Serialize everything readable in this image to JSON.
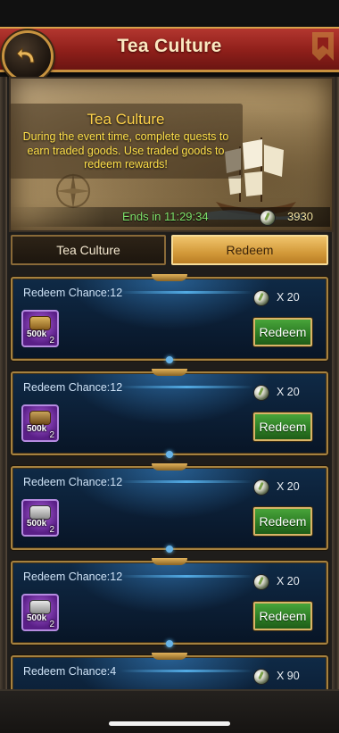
{
  "header": {
    "title": "Tea Culture"
  },
  "banner": {
    "title": "Tea Culture",
    "description": "During the event time, complete quests to earn traded goods.  Use traded goods to redeem rewards!",
    "timer": "Ends in 11:29:34",
    "goods_count": "3930"
  },
  "tabs": [
    {
      "label": "Tea Culture",
      "active": false
    },
    {
      "label": "Redeem",
      "active": true
    }
  ],
  "redeem_items": [
    {
      "label": "Redeem Chance:12",
      "cost": "X 20",
      "item_amount": "500k",
      "item_qty": "2",
      "button": "Redeem"
    },
    {
      "label": "Redeem Chance:12",
      "cost": "X 20",
      "item_amount": "500k",
      "item_qty": "2",
      "button": "Redeem"
    },
    {
      "label": "Redeem Chance:12",
      "cost": "X 20",
      "item_amount": "500k",
      "item_qty": "2",
      "button": "Redeem"
    },
    {
      "label": "Redeem Chance:12",
      "cost": "X 20",
      "item_amount": "500k",
      "item_qty": "2",
      "button": "Redeem"
    },
    {
      "label": "Redeem Chance:4",
      "cost": "X 90"
    }
  ],
  "colors": {
    "accent_gold": "#c8913f",
    "header_red": "#8e1f1a",
    "button_green": "#2b7a23",
    "timer_green": "#7de06a"
  },
  "icons": {
    "back": "back-arrow-icon",
    "goods": "traded-goods-icon"
  }
}
